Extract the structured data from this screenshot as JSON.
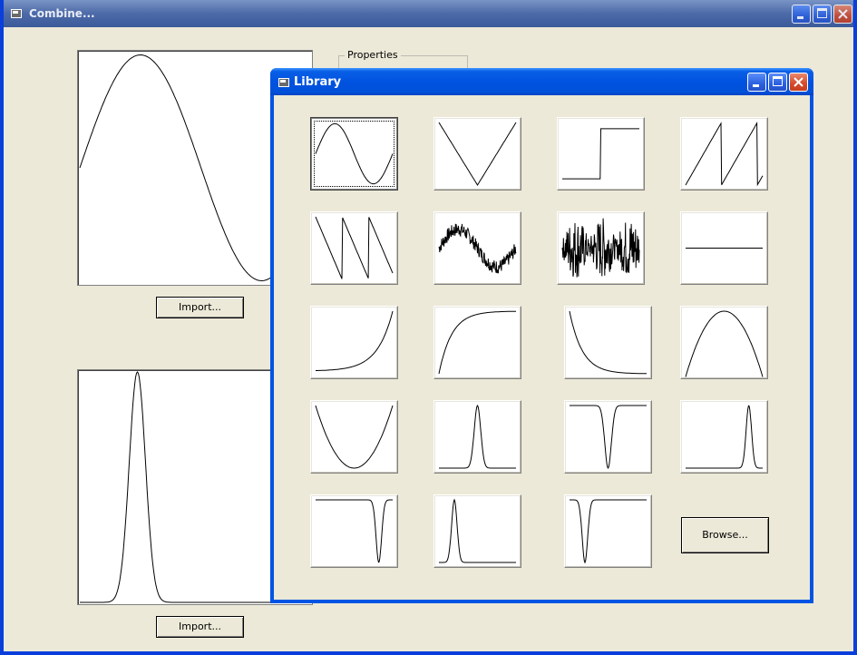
{
  "main_window": {
    "title": "Combine...",
    "import_top_label": "Import...",
    "import_bottom_label": "Import...",
    "properties_label": "Properties"
  },
  "library_window": {
    "title": "Library",
    "browse_label": "Browse...",
    "thumbnails": [
      "sine-wave",
      "triangle-wave",
      "square-step",
      "sawtooth-wave",
      "reverse-sawtooth-wave",
      "noisy-sine",
      "random-noise",
      "flat-line",
      "exponential-growth",
      "exponential-saturation",
      "exponential-decay",
      "parabola-down",
      "parabola-up",
      "centered-peak",
      "centered-dip",
      "right-peak",
      "right-dip",
      "left-peak",
      "left-dip"
    ],
    "selected_index": 0
  },
  "colors": {
    "xp_blue_title": "#0054e3",
    "inactive_title": "#7893c4",
    "dialog_face": "#ece9d8",
    "close_red": "#d5492a"
  }
}
